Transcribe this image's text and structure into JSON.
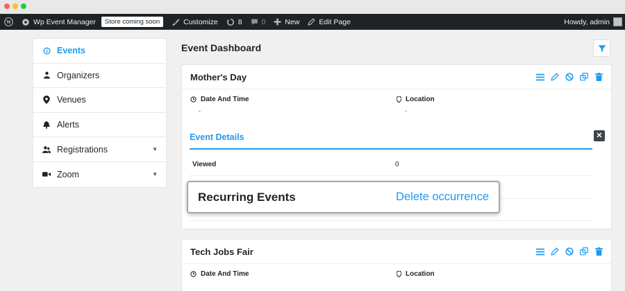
{
  "colors": {
    "accent": "#1e9bf0",
    "admin_bar": "#1d2327",
    "close_button": "#3c434a"
  },
  "admin_bar": {
    "site_name": "Wp Event Manager",
    "store_badge": "Store coming soon",
    "customize": "Customize",
    "updates_count": "8",
    "comments_count": "0",
    "new_label": "New",
    "edit_page": "Edit Page",
    "howdy": "Howdy, admin"
  },
  "sidebar": {
    "items": [
      {
        "label": "Events",
        "icon": "info-icon"
      },
      {
        "label": "Organizers",
        "icon": "user-icon"
      },
      {
        "label": "Venues",
        "icon": "map-pin-icon"
      },
      {
        "label": "Alerts",
        "icon": "bell-icon"
      },
      {
        "label": "Registrations",
        "icon": "users-icon",
        "has_caret": true
      },
      {
        "label": "Zoom",
        "icon": "video-icon",
        "has_caret": true
      }
    ]
  },
  "dashboard": {
    "title": "Event Dashboard"
  },
  "events": [
    {
      "title": "Mother's Day",
      "date_label": "Date And Time",
      "date_value": "-",
      "location_label": "Location",
      "location_value": "-",
      "details_title": "Event Details",
      "details": [
        {
          "label": "Viewed",
          "value": "0"
        }
      ]
    },
    {
      "title": "Tech Jobs Fair",
      "date_label": "Date And Time",
      "location_label": "Location"
    }
  ],
  "recurring": {
    "title": "Recurring Events",
    "link": "Delete occurrence"
  }
}
